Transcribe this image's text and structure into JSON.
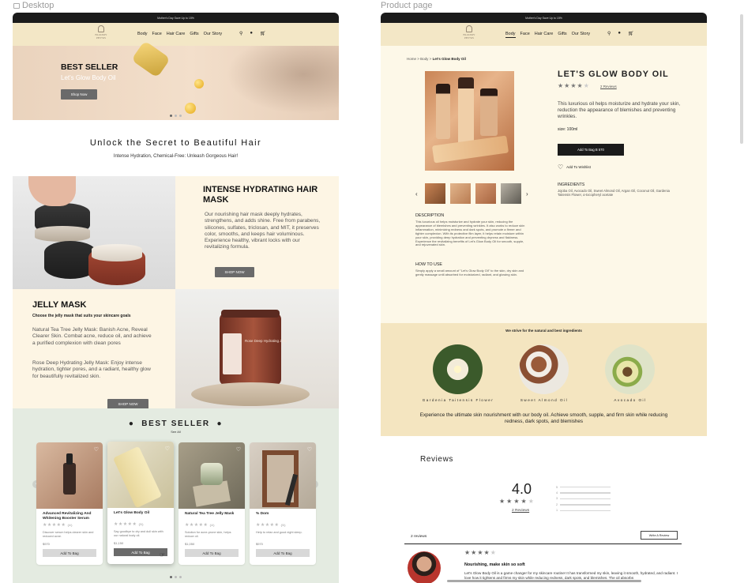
{
  "frames": {
    "desktop_label": "Desktop",
    "product_label": "Product page"
  },
  "promo_text": "Mother's Day Save Up to 15%",
  "brand": {
    "line1": "BLOOMY",
    "line2": "PHYSIS"
  },
  "nav": {
    "items": [
      "Body",
      "Face",
      "Hair Care",
      "Gifts",
      "Our Story"
    ],
    "active_product": "Body"
  },
  "hero": {
    "title": "BEST SELLER",
    "subtitle": "Let's Glow Body Oil",
    "button": "Shop Now"
  },
  "secret": {
    "title": "Unlock the Secret to Beautiful Hair",
    "subtitle": "Intense Hydration, Chemical-Free: Unleash Gorgeous Hair!"
  },
  "hair_mask": {
    "title": "INTENSE HYDRATING HAIR MASK",
    "body": "Our nourishing hair mask deeply hydrates, strengthens, and adds shine. Free from parabens, silicones, sulfates, triclosan, and MIT, it preserves color, smooths, and keeps hair voluminous. Experience healthy, vibrant locks with our revitalizing formula.",
    "button": "SHOP NOW"
  },
  "jelly": {
    "title": "JELLY MASK",
    "lead": "Choose the jelly mask that suits your skincare goals",
    "p1": "Natural Tea Tree Jelly Mask: Banish Acne, Reveal Clearer Skin. Combat acne, reduce oil, and achieve a purified complexion with clean pores",
    "p2": "Rose Deep Hydrating Jelly Mask: Enjoy intense hydration, tighter pores, and a radiant, healthy glow for beautifully revitalized skin.",
    "button": "SHOP NOW"
  },
  "jar_label": "Rose Deep Hydrating Jelly",
  "bestseller": {
    "title": "BEST SELLER",
    "see_all": "See All",
    "cards": [
      {
        "name": "Advanced Revitalizing And Whitening Booster Serum",
        "reviews": "(4)",
        "desc": "Discover serum helps clearer skin and reduced acne.",
        "price": "$970",
        "button": "Add To Bag"
      },
      {
        "name": "Let's Glow Body Oil",
        "reviews": "(5)",
        "desc": "Say goodbye to dry and dull skin with our natural body oil.",
        "price": "$1,150",
        "button": "Add To Bag"
      },
      {
        "name": "Natural Tea Tree Jelly Mask",
        "reviews": "(4)",
        "desc": "Solution for acne-prone skin, helps reduce oil.",
        "price": "$1,050",
        "button": "Add To Bag"
      },
      {
        "name": "% Dom",
        "reviews": "(5)",
        "desc": "Help to relax and good night sleep.",
        "price": "$970",
        "button": "Add To Bag"
      }
    ]
  },
  "product": {
    "breadcrumb": [
      "Home",
      "Body",
      "Let's Glow Body Oil"
    ],
    "title": "LET'S GLOW BODY OIL",
    "rating": 4,
    "reviews_link": "2 Reviews",
    "description": "This luxurious oil helps moisturize and hydrate your skin, reduction the appearance of blemishes and preventing wrinkles.",
    "size": "size: 100ml",
    "add_button": "Add To Bag  B 570",
    "wishlist": "Add To Wishlist",
    "ingredients_heading": "INGREDIENTS",
    "ingredients": "Jojoba Oil, Avocado Oil, Sweet Almond Oil, Argan Oil, Coconut Oil, Gardenia Taitensis Flower, α-tocopheryl acetate",
    "desc_heading": "DESCRIPTION",
    "desc_text": "This luxurious oil helps moisturize and hydrate your skin, reducing the appearance of blemishes and preventing wrinkles. It also works to reduce skin inflammation, minimizing redness and dark spots, and promote a firmer and tighter complexion. With its protective film layer, it helps retain moisture within your skin, providing deep hydration and preventing dryness and flakiness. Experience the revitalizing benefits of Let's Glow Body Oil for smooth, supple, and rejuvenated skin.",
    "howto_heading": "HOW TO USE",
    "howto_text": "Simply apply a small amount of \"Let's Glow Body Oil\" to the skin, dry skin and gently massage until absorbed for moisturized, radiant, and glowing skin."
  },
  "ingredients_section": {
    "heading": "We strive for the natural and best ingredients",
    "items": [
      "Gardenia Taitensis Flower",
      "Sweet Almond Oil",
      "Avocado Oil"
    ],
    "footer": "Experience the ultimate skin nourishment with our body oil. Achieve smooth, supple, and firm skin while reducing redness, dark spots, and blemishes"
  },
  "reviews": {
    "heading": "Reviews",
    "average": "4.0",
    "count_link": "2 Reviews",
    "bars": [
      "5",
      "4",
      "3",
      "2",
      "1"
    ],
    "total": "2 reviews",
    "write_button": "Write A Review",
    "item": {
      "rating": 4,
      "title": "Nourishing, make skin so soft",
      "text": "Let's Glow Body Oil is a game changer for my skincare routine! It has transformed my skin, leaving it smooth, hydrated, and radiant. I love how it tightens and firms my skin while reducing redness, dark spots, and blemishes. The oil absorbs"
    }
  },
  "colors": {
    "nav_bg": "#f3e7c6",
    "cream": "#fdf5e4",
    "bestseller_bg": "#e4ebe1",
    "ingredients_bg": "#f4e5c0"
  }
}
